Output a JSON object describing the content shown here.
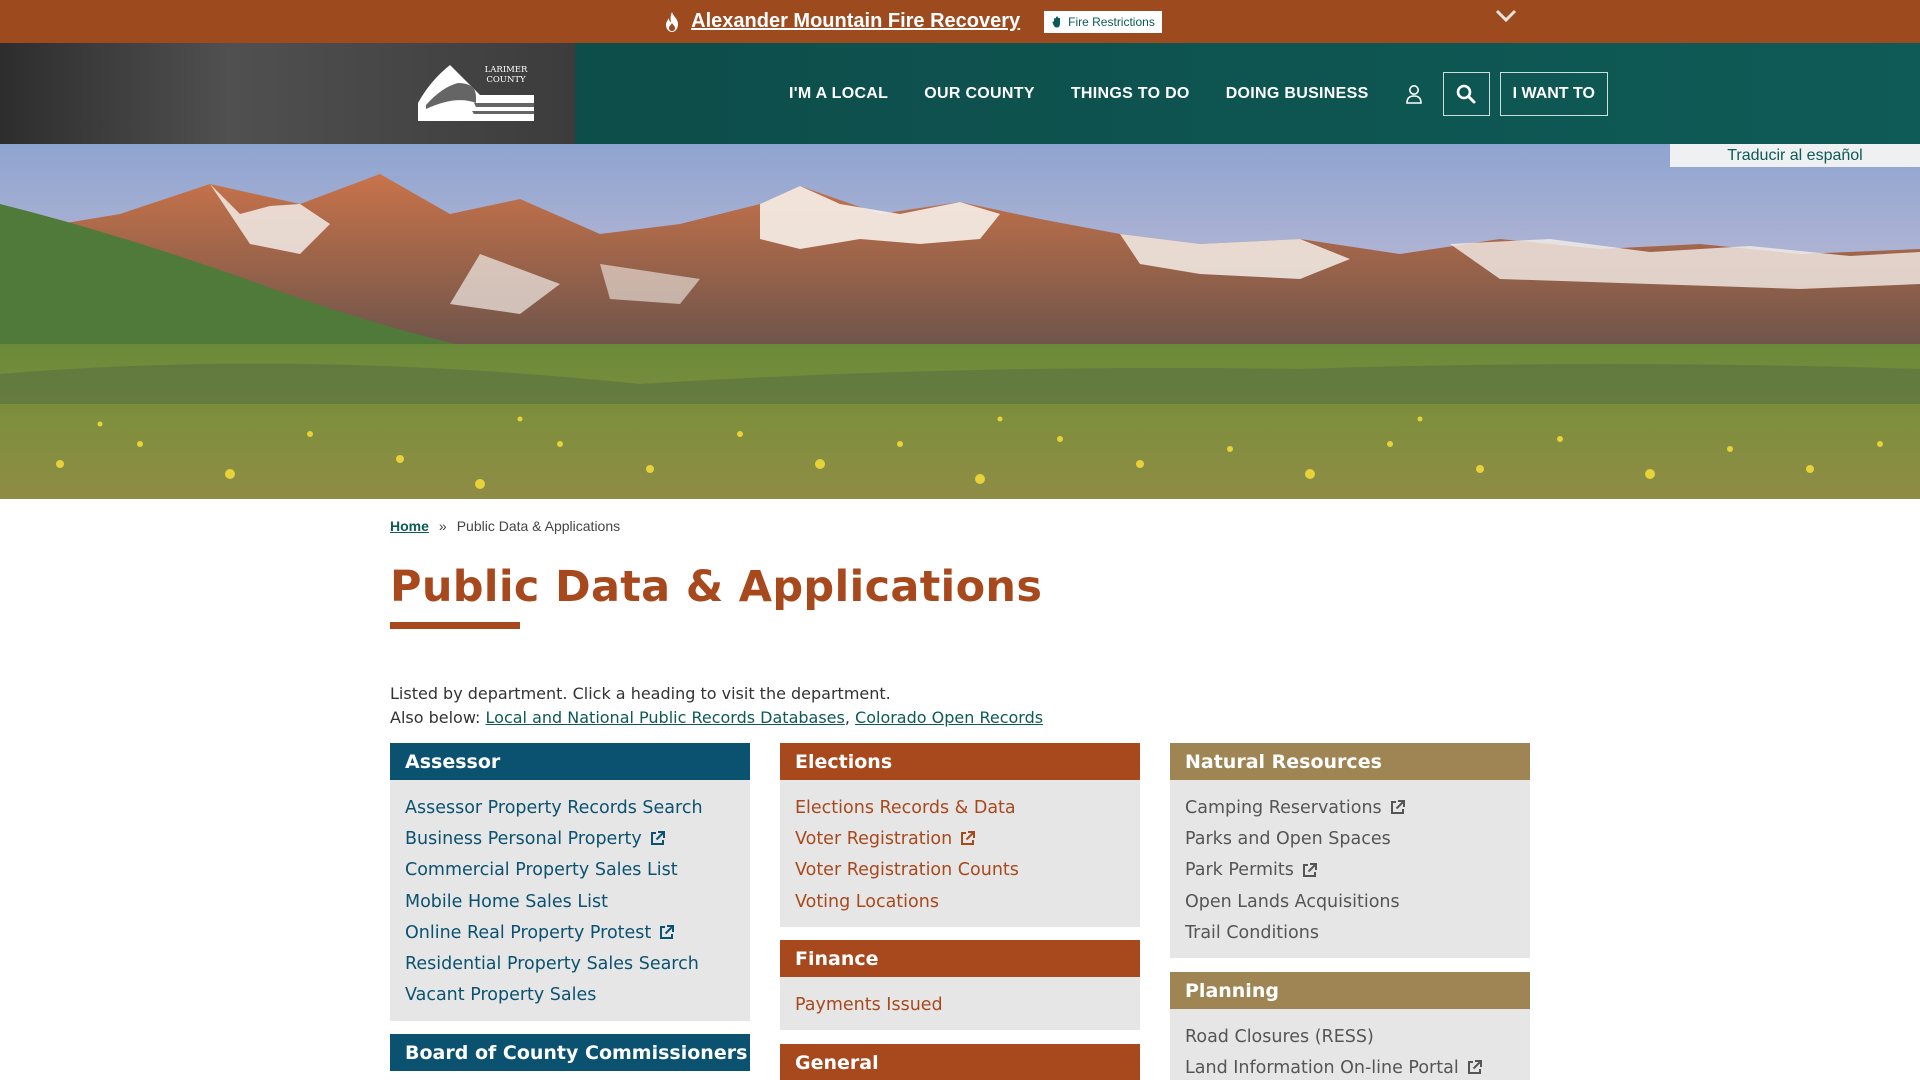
{
  "alert": {
    "link": "Alexander Mountain Fire Recovery",
    "button": "Fire Restrictions"
  },
  "logo": {
    "text_line1": "LARIMER",
    "text_line2": "COUNTY"
  },
  "nav": {
    "items": [
      "I'M A LOCAL",
      "OUR COUNTY",
      "THINGS TO DO",
      "DOING BUSINESS"
    ],
    "i_want_to": "I WANT TO"
  },
  "translate": "Traducir al español",
  "breadcrumb": {
    "home": "Home",
    "separator": "»",
    "current": "Public Data & Applications"
  },
  "page": {
    "title": "Public Data & Applications",
    "intro_line1": "Listed by department. Click a heading to visit the department.",
    "intro_prefix": "Also below: ",
    "intro_link1": "Local and National Public Records Databases",
    "intro_sep": ", ",
    "intro_link2": "Colorado Open Records"
  },
  "colors": {
    "teal": "#0d5a56",
    "blue": "#0b5270",
    "rust": "#a8491d",
    "tan": "#a08554",
    "alert": "#9e4a1f"
  },
  "cards": [
    {
      "title": "Assessor",
      "links": [
        {
          "label": "Assessor Property Records Search",
          "external": false
        },
        {
          "label": "Business Personal Property",
          "external": true
        },
        {
          "label": "Commercial Property Sales List",
          "external": false
        },
        {
          "label": "Mobile Home Sales List",
          "external": false
        },
        {
          "label": "Online Real Property Protest",
          "external": true
        },
        {
          "label": "Residential Property Sales Search",
          "external": false
        },
        {
          "label": "Vacant Property Sales",
          "external": false
        }
      ]
    },
    {
      "title": "Board of County Commissioners",
      "links": []
    },
    {
      "title": "Elections",
      "links": [
        {
          "label": "Elections Records & Data",
          "external": false
        },
        {
          "label": "Voter Registration",
          "external": true
        },
        {
          "label": "Voter Registration Counts",
          "external": false
        },
        {
          "label": "Voting Locations",
          "external": false
        }
      ]
    },
    {
      "title": "Finance",
      "links": [
        {
          "label": "Payments Issued",
          "external": false
        }
      ]
    },
    {
      "title": "General",
      "links": []
    },
    {
      "title": "Natural Resources",
      "links": [
        {
          "label": "Camping Reservations",
          "external": true
        },
        {
          "label": "Parks and Open Spaces",
          "external": false
        },
        {
          "label": "Park Permits",
          "external": true
        },
        {
          "label": "Open Lands Acquisitions",
          "external": false
        },
        {
          "label": "Trail Conditions",
          "external": false
        }
      ]
    },
    {
      "title": "Planning",
      "links": [
        {
          "label": "Road Closures (RESS)",
          "external": false
        },
        {
          "label": "Land Information On-line Portal",
          "external": true
        }
      ]
    }
  ]
}
